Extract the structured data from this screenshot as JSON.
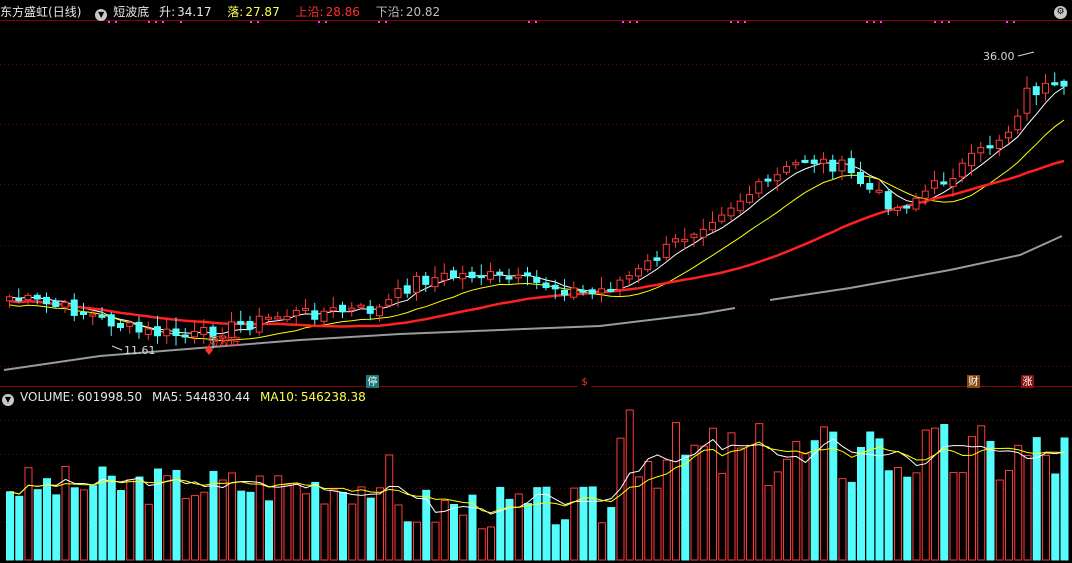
{
  "header": {
    "stock_title": "东方盛虹",
    "period": "(日线)",
    "indicator_name": "短波底",
    "rise_label": "升:",
    "rise_value": "34.17",
    "fall_label": "落:",
    "fall_value": "27.87",
    "upper_label": "上沿:",
    "upper_value": "28.86",
    "lower_label": "下沿:",
    "lower_value": "20.82",
    "settings_icon": "gear-icon"
  },
  "volume_header": {
    "volume_label": "VOLUME:",
    "volume_value": "601998.50",
    "ma5_label": "MA5:",
    "ma5_value": "544830.44",
    "ma10_label": "MA10:",
    "ma10_value": "546238.38"
  },
  "annotations": {
    "high_label": "36.00",
    "low_label": "11.61",
    "signal_label": "短波底",
    "badge_stop": "停",
    "badge_dollar": "$",
    "badge_finance": "财",
    "badge_rise": "涨"
  },
  "colors": {
    "up_candle": "#ff3a3a",
    "down_candle": "#54fcfc",
    "ma_short": "#ffffff",
    "ma_mid": "#ffff00",
    "ma_long": "#ff2020",
    "ma_extra_long": "#9a9a9a",
    "grid": "#6e0000",
    "divider": "#8a0000"
  }
}
